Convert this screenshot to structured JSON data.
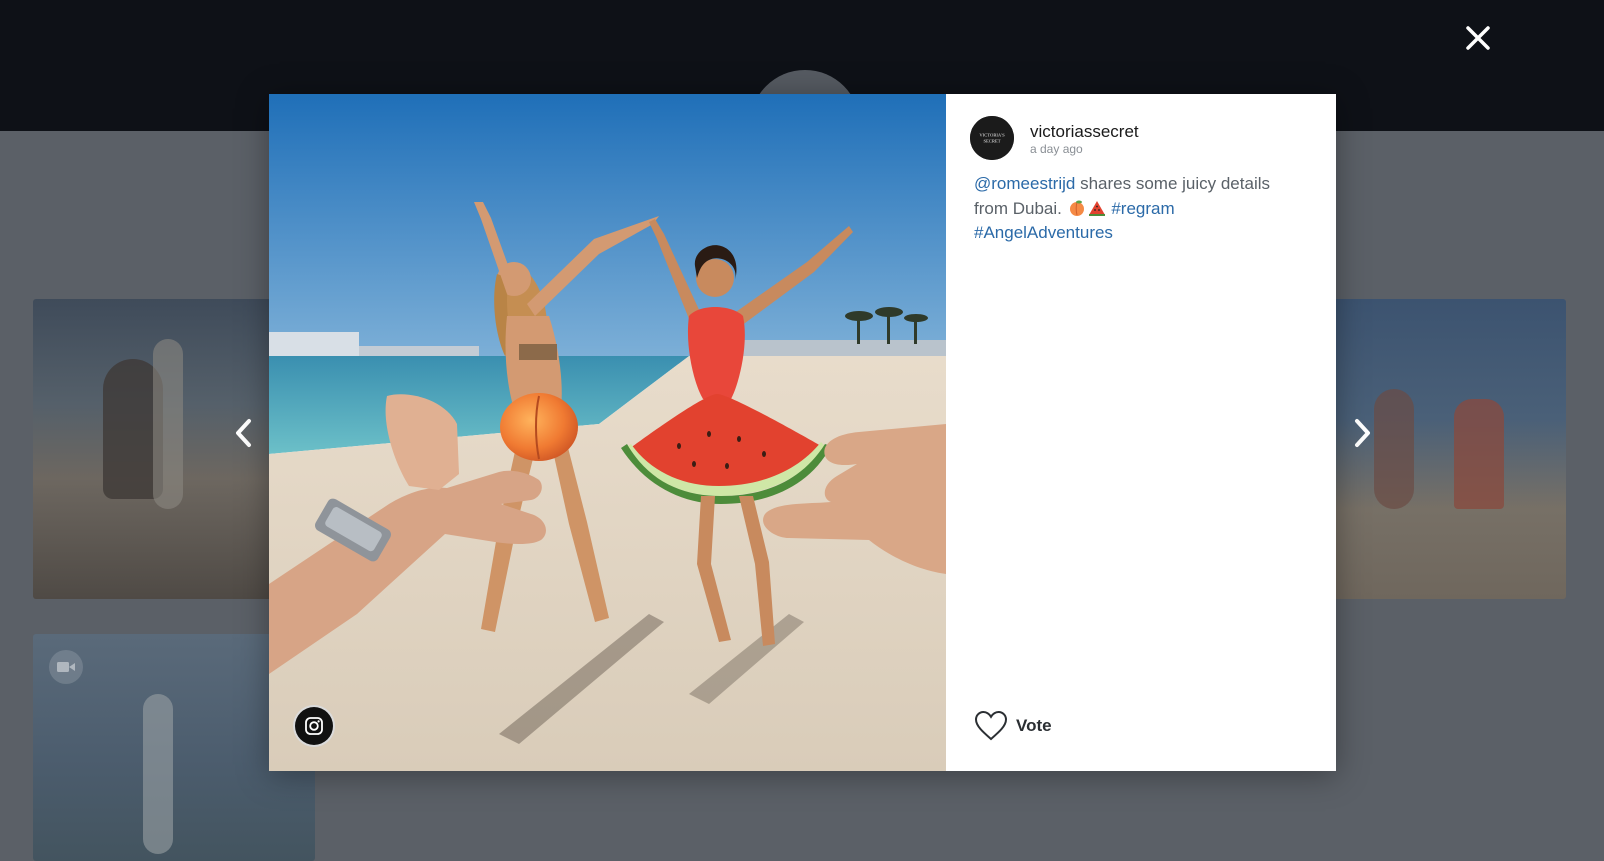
{
  "post": {
    "author": "victoriassecret",
    "avatar_text_line1": "VICTORIA'S",
    "avatar_text_line2": "SECRET",
    "time": "a day ago",
    "caption": {
      "mention": "@romeestrijd",
      "text_part1": "shares some juicy details from Dubai.",
      "emojis": [
        "peach-emoji",
        "watermelon-emoji"
      ],
      "hashtags": [
        "#regram",
        "#AngelAdventures"
      ]
    },
    "source": "instagram",
    "vote_label": "Vote"
  },
  "gallery": {
    "background_cards": [
      {
        "type": "photo",
        "subject": "rider-on-horse"
      },
      {
        "type": "video",
        "subject": "woman-at-pool"
      },
      {
        "type": "photo",
        "subject": "beach-duo-thumbnail"
      }
    ]
  },
  "icons": {
    "close": "close-icon",
    "prev": "chevron-left-icon",
    "next": "chevron-right-icon",
    "source": "instagram-icon",
    "vote": "heart-icon",
    "video": "video-camera-icon"
  },
  "colors": {
    "link": "#2b6aa8",
    "overlay": "#5b6067",
    "header": "#0e1117"
  }
}
